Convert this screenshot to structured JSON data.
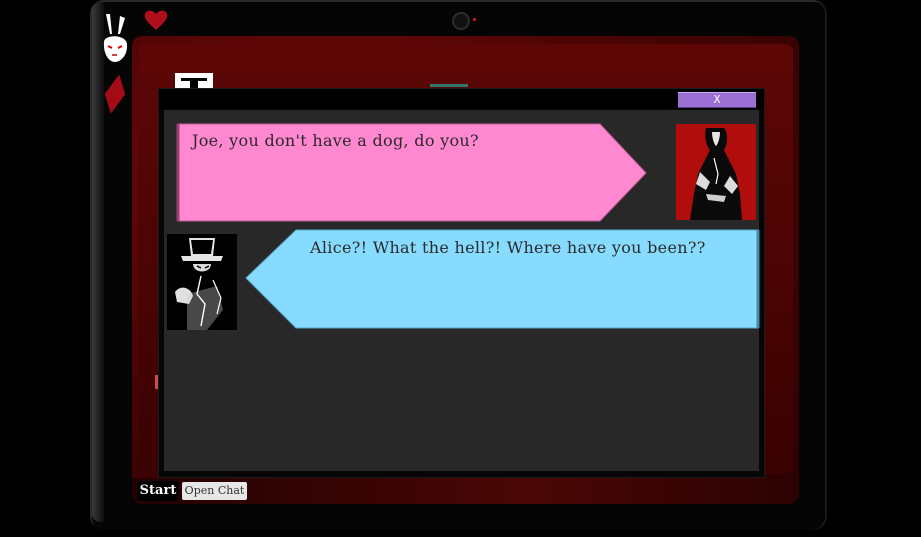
{
  "chat_window": {
    "close_label": "X",
    "messages": [
      {
        "speaker": "alice",
        "side": "left",
        "text": "Joe, you don't have a dog, do you?",
        "bubble_color": "#ff88d0"
      },
      {
        "speaker": "joe",
        "side": "right",
        "text": "Alice?! What the hell?! Where have you been??",
        "bubble_color": "#87dbff"
      }
    ]
  },
  "taskbar": {
    "start_label": "Start",
    "open_chat_label": "Open Chat"
  },
  "colors": {
    "screen_red": "#4a0404",
    "close_button": "#9b6fd4",
    "alice_avatar_bg": "#b20d0d"
  },
  "icons": [
    "bunny-icon",
    "heart-icon",
    "diamond-icon",
    "camera-icon"
  ]
}
